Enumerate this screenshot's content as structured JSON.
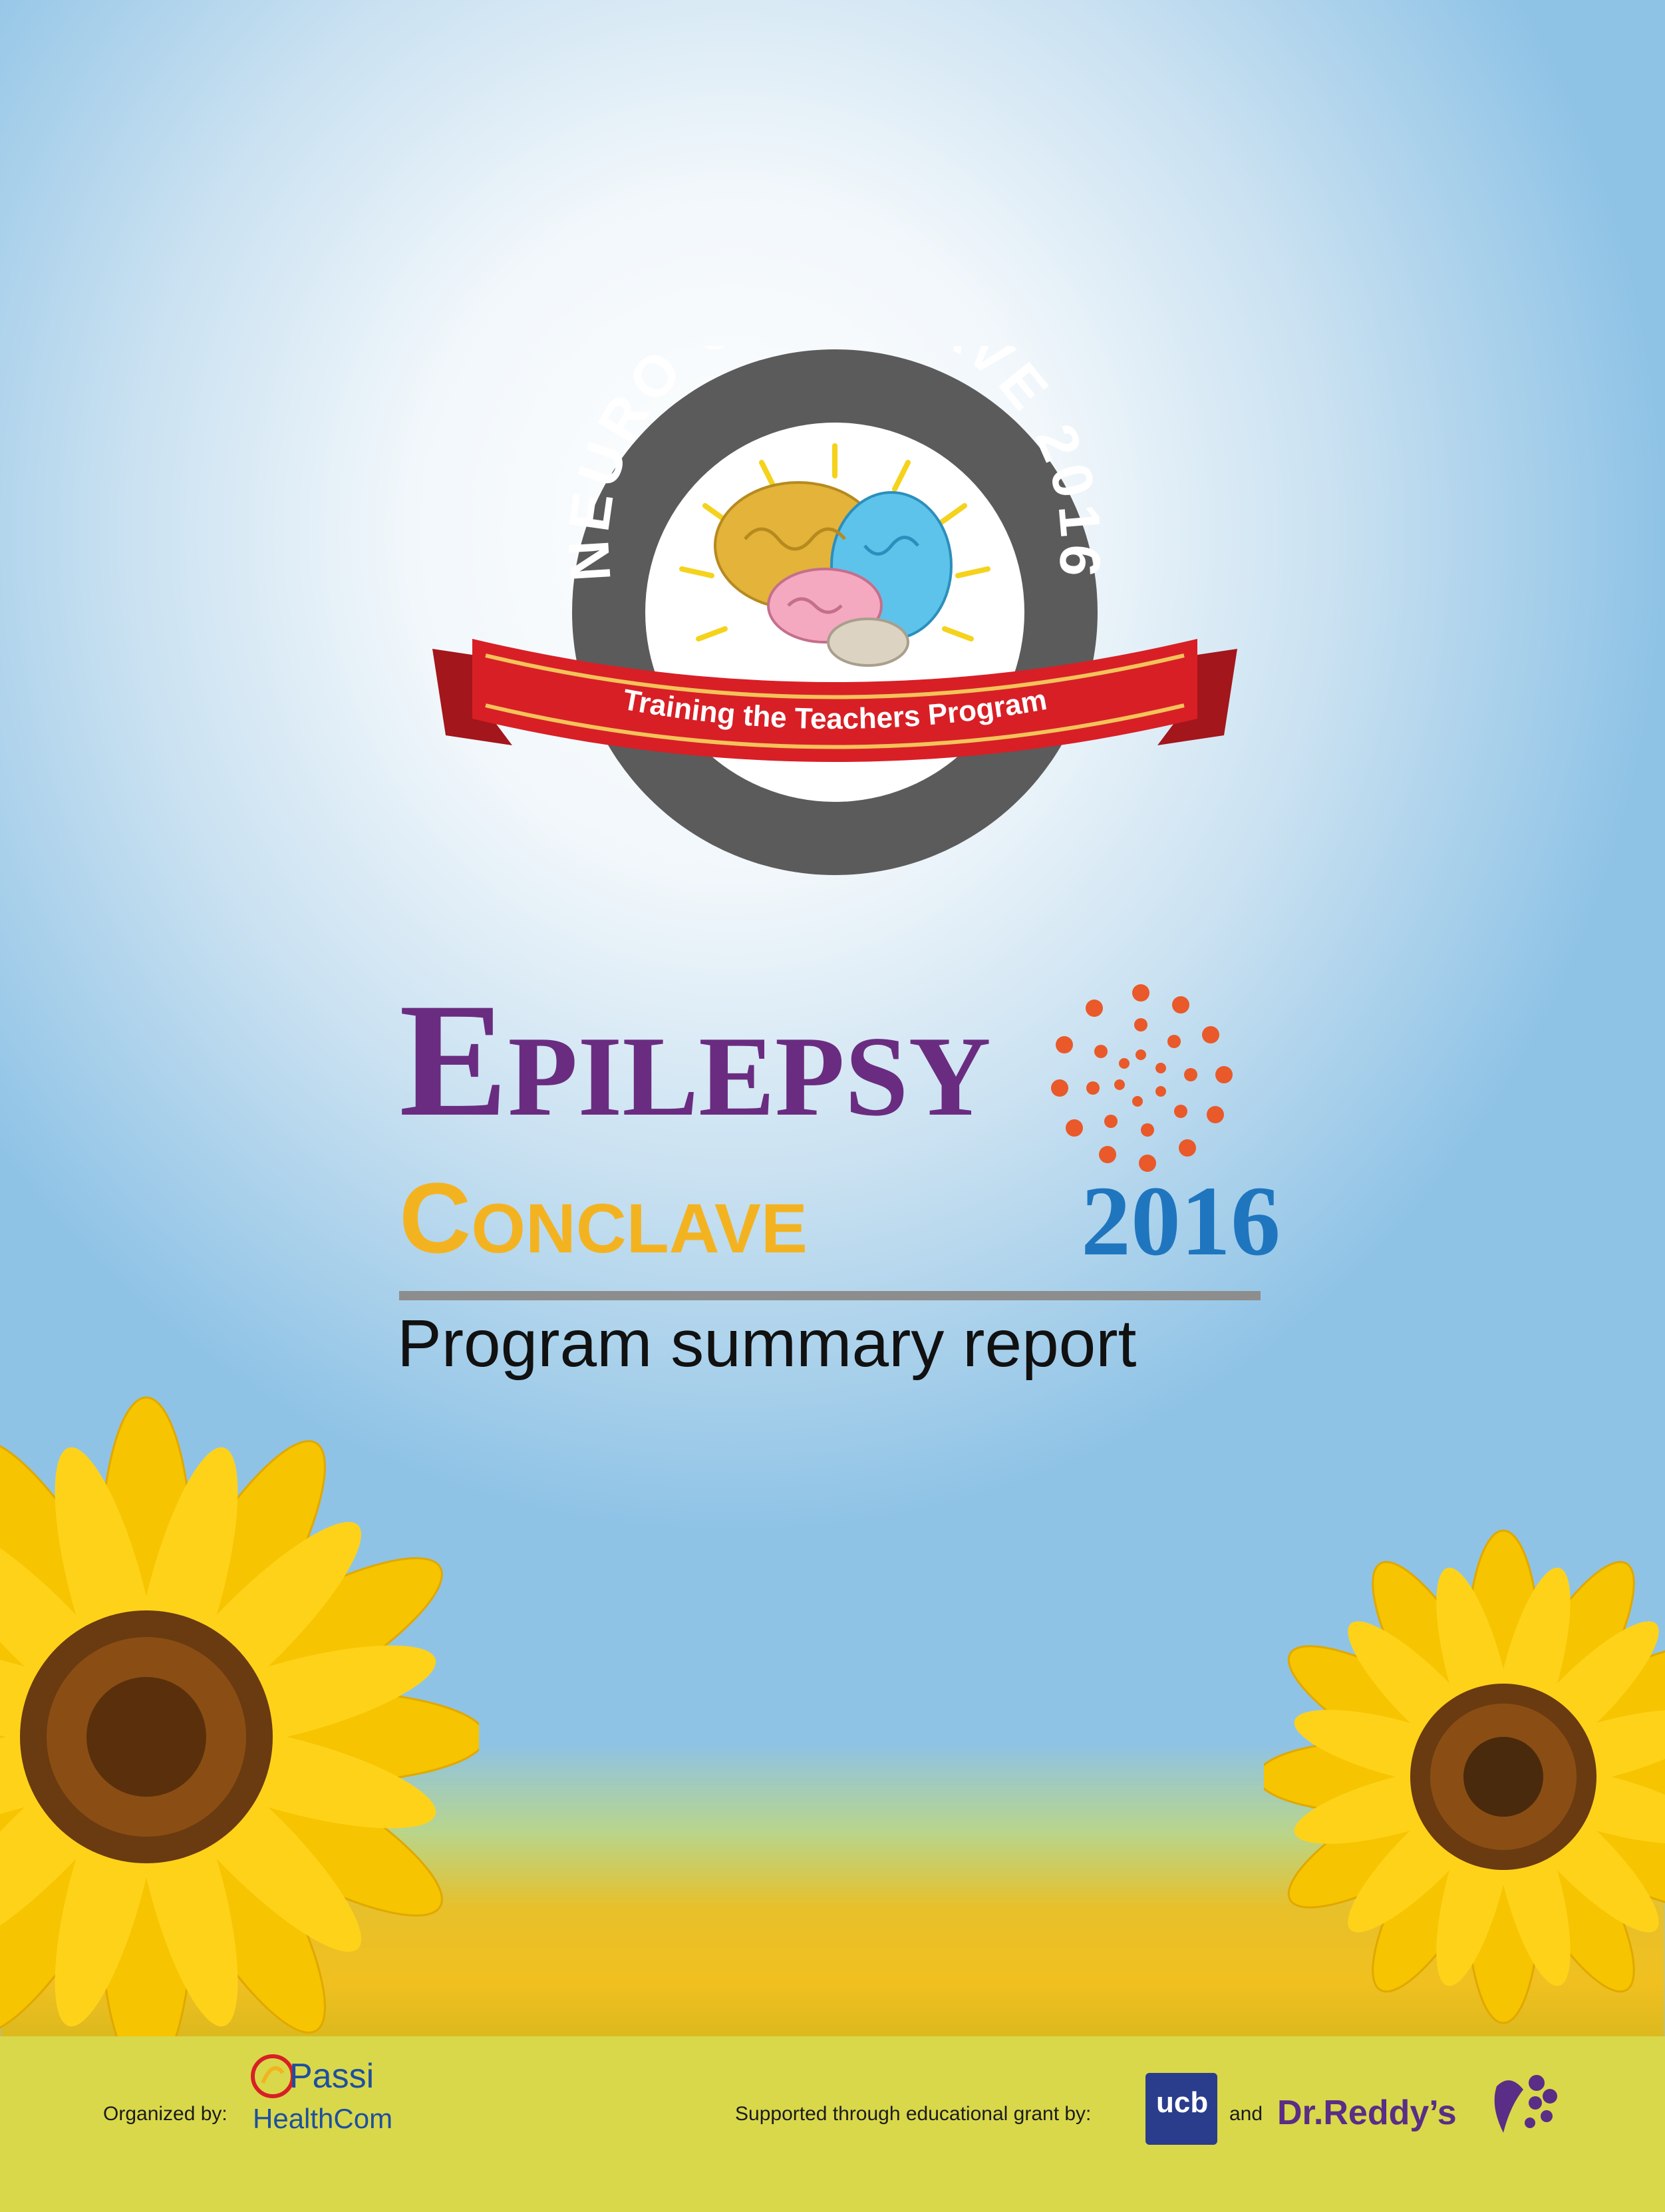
{
  "badge": {
    "ring_text": "NEURO CONCLAVE 2016",
    "ribbon_text": "Training the Teachers Program"
  },
  "title": {
    "line1": "Epilepsy",
    "line2": "Conclave",
    "year": "2016",
    "subtitle": "Program summary report"
  },
  "footer": {
    "organized_label": "Organized by:",
    "organizer_name": "Passi",
    "organizer_sub": "HealthCom",
    "support_label": "Supported through educational grant by:",
    "sponsor1": "ucb",
    "and_label": "and",
    "sponsor2": "Dr.Reddy’s"
  },
  "colors": {
    "epilepsy_purple": "#6a2c80",
    "conclave_gold": "#f3b321",
    "year_blue": "#1f76bf",
    "ribbon_red": "#d81f26",
    "ring_grey": "#5b5b5b"
  }
}
